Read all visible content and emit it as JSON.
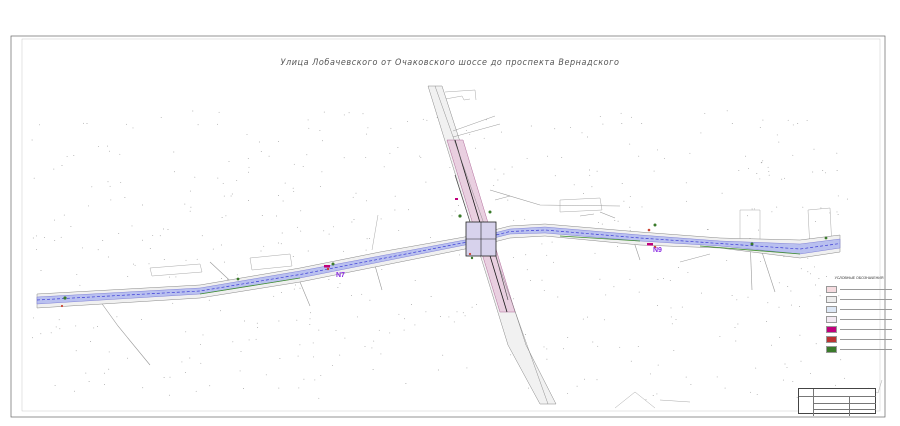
{
  "title": "Улица Лобачевского от Очаковского шоссе до проспекта Вернадского",
  "segment_labels": [
    "N7",
    "N9"
  ],
  "legend": {
    "title": "УСЛОВНЫЕ ОБОЗНАЧЕНИЯ",
    "items": [
      {
        "color": "#f6dce0"
      },
      {
        "color": "#eeeeee"
      },
      {
        "color": "#dde8f6"
      },
      {
        "color": "#f3eaf3"
      },
      {
        "color": "#c0007c"
      },
      {
        "color": "#b33"
      },
      {
        "color": "#3a7a2a"
      }
    ]
  },
  "colors": {
    "carriageway": "#b9c0ef",
    "centerline": "#3b3bd6",
    "cross_street": "#e9cfe0",
    "green": "#3f8f2f",
    "segment_label": "#8a2be2"
  }
}
